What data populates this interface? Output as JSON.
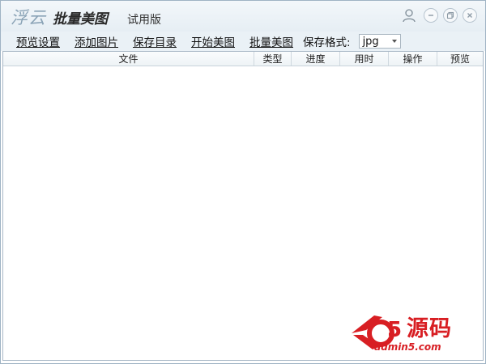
{
  "app": {
    "brand_cloud": "浮云",
    "brand_product": "批量美图",
    "edition": "试用版"
  },
  "menu": {
    "items": [
      "预览设置",
      "添加图片",
      "保存目录",
      "开始美图",
      "批量美图"
    ],
    "format_label": "保存格式:",
    "format_value": "jpg"
  },
  "table": {
    "columns": [
      "文件",
      "类型",
      "进度",
      "用时",
      "操作",
      "预览"
    ],
    "rows": []
  },
  "watermark": {
    "text": "源码",
    "url": "admin5.com"
  },
  "colors": {
    "accent": "#d81e23",
    "titlebar": "#e6eef4",
    "menubar": "#eaf1f6"
  }
}
